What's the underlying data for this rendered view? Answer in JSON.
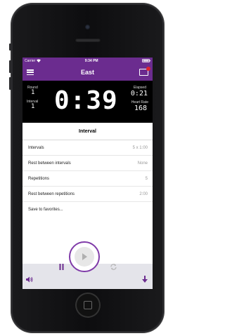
{
  "status_bar": {
    "carrier": "Carrier",
    "time": "9:34 PM"
  },
  "nav": {
    "title": "East"
  },
  "timer": {
    "round_label": "Round",
    "round_value": "1",
    "interval_label": "Interval",
    "interval_value": "1",
    "main_time": "0:39",
    "elapsed_label": "Elapsed",
    "elapsed_value": "0:21",
    "heart_rate_label": "Heart Rate",
    "heart_rate_value": "168"
  },
  "section_title": "Interval",
  "rows": [
    {
      "label": "Intervals",
      "value": "5 x 1:00"
    },
    {
      "label": "Rest between intervals",
      "value": "None"
    },
    {
      "label": "Repetitions",
      "value": "5"
    },
    {
      "label": "Rest between repetitions",
      "value": "2:00"
    },
    {
      "label": "Save to favorites...",
      "value": ""
    }
  ],
  "colors": {
    "accent": "#6b2c8f",
    "badge": "#e0232e"
  }
}
